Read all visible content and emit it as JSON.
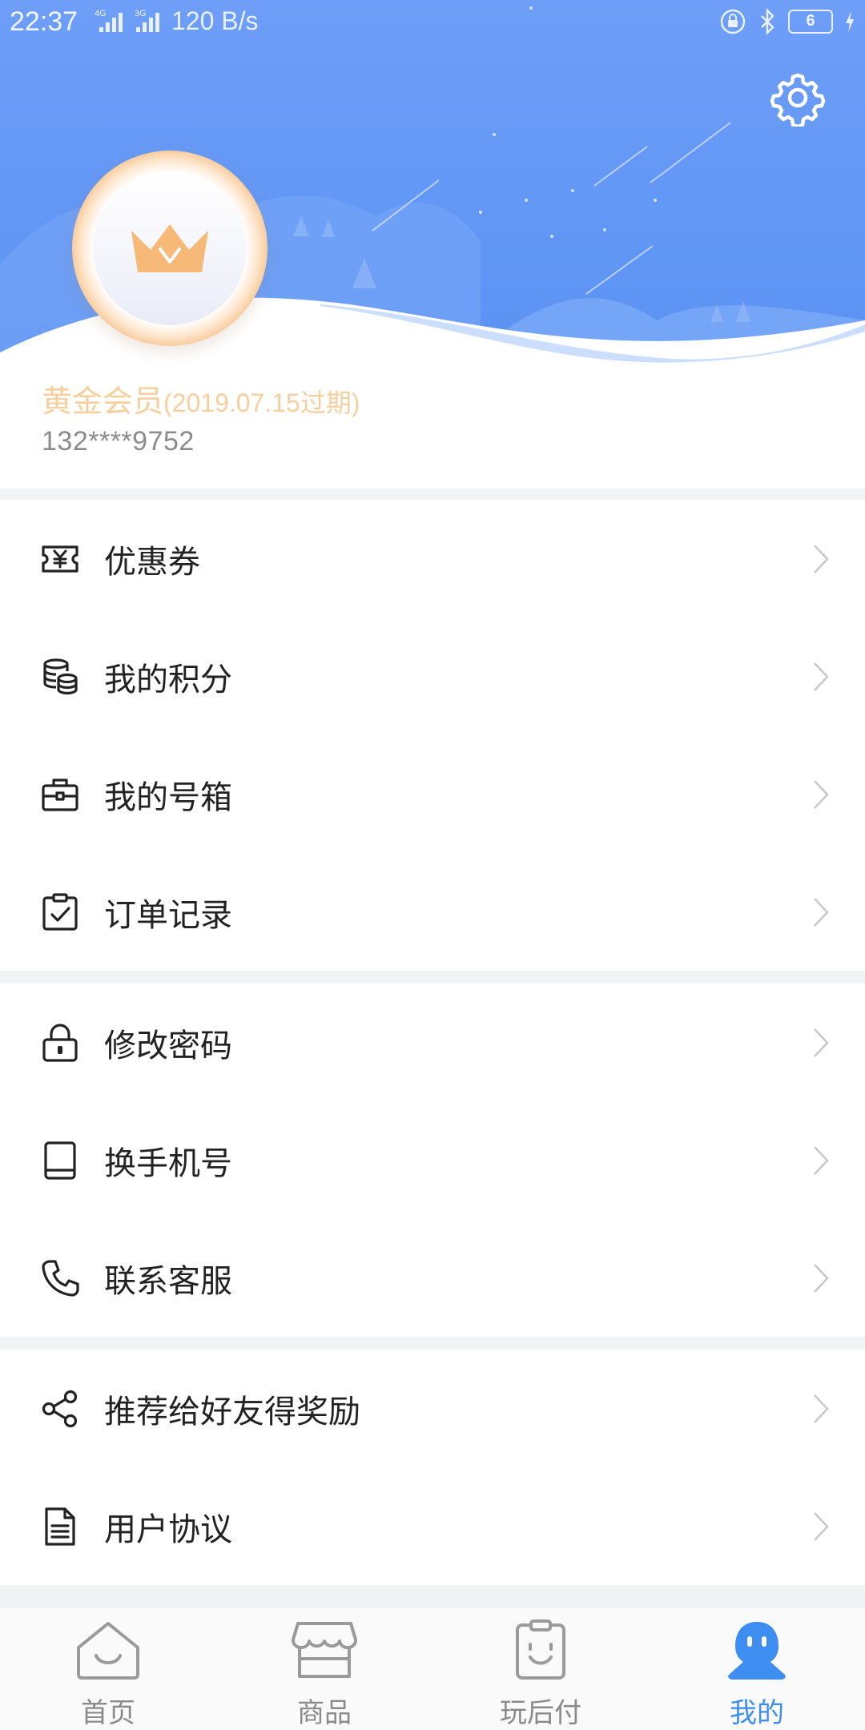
{
  "status_bar": {
    "time": "22:37",
    "network_speed": "120 B/s",
    "battery_level": "6"
  },
  "profile": {
    "membership": "黄金会员",
    "expiry": "(2019.07.15过期)",
    "phone": "132****9752"
  },
  "menu_groups": [
    [
      {
        "label": "优惠券",
        "icon": "coupon-icon"
      },
      {
        "label": "我的积分",
        "icon": "coins-icon"
      },
      {
        "label": "我的号箱",
        "icon": "toolbox-icon"
      },
      {
        "label": "订单记录",
        "icon": "clipboard-check-icon"
      }
    ],
    [
      {
        "label": "修改密码",
        "icon": "lock-icon"
      },
      {
        "label": "换手机号",
        "icon": "phone-device-icon"
      },
      {
        "label": "联系客服",
        "icon": "telephone-icon"
      }
    ],
    [
      {
        "label": "推荐给好友得奖励",
        "icon": "share-icon"
      },
      {
        "label": "用户协议",
        "icon": "document-icon"
      }
    ]
  ],
  "tabbar": {
    "tabs": [
      {
        "label": "首页",
        "icon": "home-icon",
        "active": false
      },
      {
        "label": "商品",
        "icon": "shop-icon",
        "active": false
      },
      {
        "label": "玩后付",
        "icon": "clipboard-smile-icon",
        "active": false
      },
      {
        "label": "我的",
        "icon": "profile-mascot-icon",
        "active": true
      }
    ]
  },
  "colors": {
    "header_blue": "#5b95f5",
    "gold": "#f6cf9d",
    "active_tab": "#3d8ef0"
  }
}
